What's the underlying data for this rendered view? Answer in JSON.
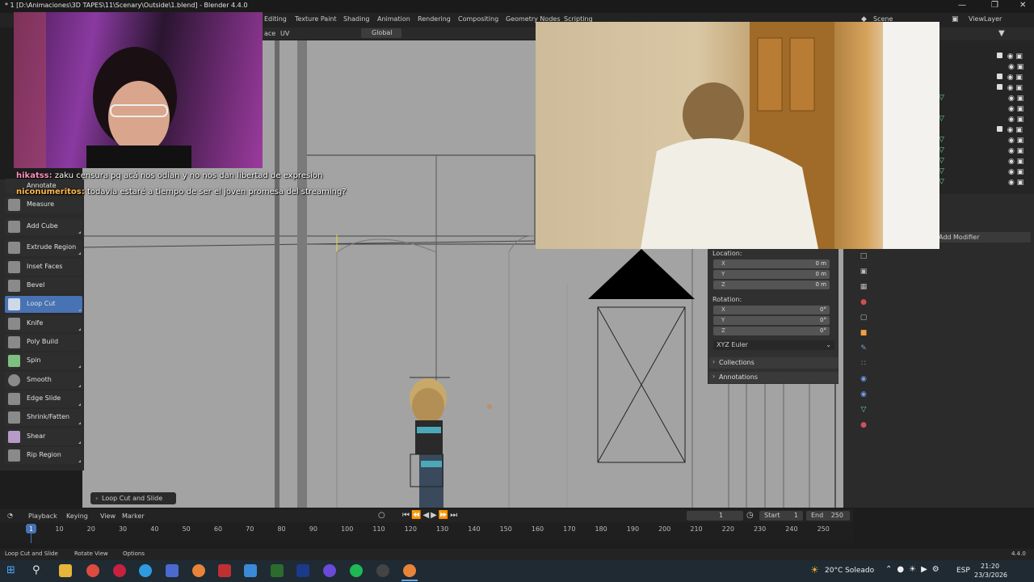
{
  "window": {
    "title": "* 1 [D:\\Animaciones\\3D TAPES\\11\\Scenary\\Outside\\1.blend] - Blender 4.4.0",
    "minimize": "—",
    "maximize": "❐",
    "close": "✕"
  },
  "workspaces": [
    "Editing",
    "Texture Paint",
    "Shading",
    "Animation",
    "Rendering",
    "Compositing",
    "Geometry Nodes",
    "Scripting"
  ],
  "scene": {
    "scene_label": "Scene",
    "viewlayer_label": "ViewLayer"
  },
  "viewport_header": {
    "menu_face": "ace",
    "menu_uv": "UV",
    "orientation": "Global"
  },
  "chat": [
    {
      "user": "hikatss:",
      "message": "zaku censura pq acá nos odian y no nos dan libertad de expresion"
    },
    {
      "user": "niconumeritos:",
      "message": "todavia estaré a tiempo de ser el joven promesa del streaming?"
    }
  ],
  "tools": {
    "annotate": "Annotate",
    "measure": "Measure",
    "add_cube": "Add Cube",
    "extrude_region": "Extrude Region",
    "inset_faces": "Inset Faces",
    "bevel": "Bevel",
    "loop_cut": "Loop Cut",
    "knife": "Knife",
    "poly_build": "Poly Build",
    "spin": "Spin",
    "smooth": "Smooth",
    "edge_slide": "Edge Slide",
    "shrink_fatten": "Shrink/Fatten",
    "shear": "Shear",
    "rip_region": "Rip Region"
  },
  "operator_panel": "Loop Cut and Slide",
  "properties": {
    "add_modifier": "Add Modifier",
    "location_label": "Location:",
    "rotation_label": "Rotation:",
    "location": [
      {
        "axis": "X",
        "value": "0 m"
      },
      {
        "axis": "Y",
        "value": "0 m"
      },
      {
        "axis": "Z",
        "value": "0 m"
      }
    ],
    "rotation": [
      {
        "axis": "X",
        "value": "0°"
      },
      {
        "axis": "Y",
        "value": "0°"
      },
      {
        "axis": "Z",
        "value": "0°"
      }
    ],
    "rotation_mode": "XYZ Euler",
    "collections": "Collections",
    "annotations": "Annotations"
  },
  "timeline": {
    "playback": "Playback",
    "keying": "Keying",
    "view": "View",
    "marker": "Marker",
    "current_frame": "1",
    "start_label": "Start",
    "start_value": "1",
    "end_label": "End",
    "end_value": "250",
    "ticks": [
      "1",
      "10",
      "20",
      "30",
      "40",
      "50",
      "60",
      "70",
      "80",
      "90",
      "100",
      "110",
      "120",
      "130",
      "140",
      "150",
      "160",
      "170",
      "180",
      "190",
      "200",
      "210",
      "220",
      "230",
      "240",
      "250"
    ]
  },
  "statusbar": {
    "item1": "Loop Cut and Slide",
    "item2": "Rotate View",
    "item3": "Options",
    "version": "4.4.0"
  },
  "taskbar": {
    "weather": "20°C Soleado",
    "language": "ESP",
    "time": "21:20",
    "date": "23/3/2026"
  },
  "colors": {
    "accent": "#4772b3",
    "viewport_bg": "#a3a3a3",
    "panel_bg": "#2b2b2b"
  }
}
